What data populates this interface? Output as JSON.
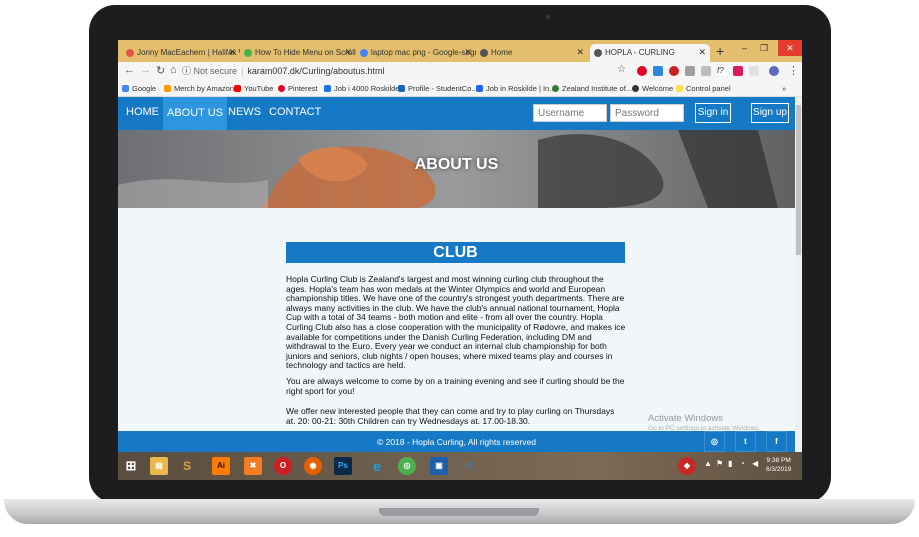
{
  "browser": {
    "tabs": [
      {
        "label": "Jonny MacEachern | Halifax Wri",
        "icon": "pocket-icon",
        "color": "#e5534b"
      },
      {
        "label": "How To Hide Menu on Scroll",
        "icon": "arrow-icon",
        "color": "#4caf50"
      },
      {
        "label": "laptop mac png - Google-søgn",
        "icon": "google-icon",
        "color": "#4285f4"
      },
      {
        "label": "Home",
        "icon": "globe-icon",
        "color": "#555555"
      },
      {
        "label": "HOPLA - CURLING",
        "icon": "globe-icon",
        "color": "#555555"
      }
    ],
    "new_tab": "+",
    "window_controls": {
      "minimize": "–",
      "maximize": "❐",
      "close": "✕"
    },
    "address": {
      "security": "Not secure",
      "url": "karam007.dk/Curling/aboutus.html"
    },
    "bookmarks": [
      {
        "label": "Google",
        "color": "#4285f4"
      },
      {
        "label": "Merch by Amazon",
        "color": "#ff9900"
      },
      {
        "label": "YouTube",
        "color": "#ff0000"
      },
      {
        "label": "Pinterest",
        "color": "#e60023"
      },
      {
        "label": "Job i 4000 Roskilde...",
        "color": "#1a73e8"
      },
      {
        "label": "Profile - StudentCo...",
        "color": "#1565c0"
      },
      {
        "label": "Job in Roskilde | In...",
        "color": "#2164f3"
      },
      {
        "label": "Zealand Institute of...",
        "color": "#2e7d32"
      },
      {
        "label": "Welcome",
        "color": "#333333"
      },
      {
        "label": "Control panel",
        "color": "#f9e04b"
      }
    ],
    "bookmarks_more": "»"
  },
  "site": {
    "nav": [
      {
        "label": "HOME"
      },
      {
        "label": "ABOUT US"
      },
      {
        "label": "NEWS"
      },
      {
        "label": "CONTACT"
      }
    ],
    "username_placeholder": "Username",
    "password_placeholder": "Password",
    "signin_label": "Sign in",
    "signup_label": "Sign up",
    "hero_title": "ABOUT US",
    "section_title": "CLUB",
    "paragraphs": [
      "Hopla Curling Club is Zealand's largest and most winning curling club throughout the ages. Hopla's team has won medals at the Winter Olympics and world and European championship titles. We have one of the country's strongest youth departments. There are always many activities in the club. We have the club's annual national tournament, Hopla Cup with a total of 34 teams - both motion and elite - from all over the country. Hopla Curling Club also has a close cooperation with the municipality of Rødovre, and makes ice available for competitions under the Danish Curling Federation, including DM and withdrawal to the Euro. Every year we conduct an internal club championship for both juniors and seniors, club nights / open houses, where mixed teams play and courses in technology and tactics are held.",
      "You are always welcome to come by on a training evening and see if curling should be the right sport for you!",
      "We offer new interested people that they can come and try to play curling on Thursdays at. 20: 00-21: 30th Children can try Wednesdays at. 17.00-18.30."
    ],
    "footer_text": "© 2018 - Hopla Curling, All rights reserved",
    "social": [
      {
        "name": "instagram-icon",
        "glyph": "◎"
      },
      {
        "name": "twitter-icon",
        "glyph": "t"
      },
      {
        "name": "facebook-icon",
        "glyph": "f"
      }
    ]
  },
  "watermark": {
    "line1": "Activate Windows",
    "line2": "Go to PC settings to activate Windows."
  },
  "taskbar": {
    "apps": [
      {
        "name": "start-icon",
        "glyph": "⊞",
        "color": "#2d2d2d"
      },
      {
        "name": "file-explorer-icon",
        "glyph": "▤",
        "color": "#e8b84a"
      },
      {
        "name": "slack-icon",
        "glyph": "S",
        "color": "#e0a23b"
      },
      {
        "name": "illustrator-icon",
        "glyph": "Ai",
        "color": "#ff7c00"
      },
      {
        "name": "xampp-icon",
        "glyph": "✖",
        "color": "#f57c20"
      },
      {
        "name": "opera-icon",
        "glyph": "O",
        "color": "#cc1f25"
      },
      {
        "name": "firefox-icon",
        "glyph": "◉",
        "color": "#e66000"
      },
      {
        "name": "photoshop-icon",
        "glyph": "Ps",
        "color": "#0b2a4a"
      },
      {
        "name": "ie-icon",
        "glyph": "e",
        "color": "#1ba1e2"
      },
      {
        "name": "chrome-icon",
        "glyph": "◎",
        "color": "#4caf50"
      },
      {
        "name": "virtualbox-icon",
        "glyph": "▣",
        "color": "#1d5fa8"
      },
      {
        "name": "vscode-icon",
        "glyph": "⟨⟩",
        "color": "#1f88d8"
      }
    ],
    "time": "9:38 PM",
    "date": "6/3/2019"
  }
}
